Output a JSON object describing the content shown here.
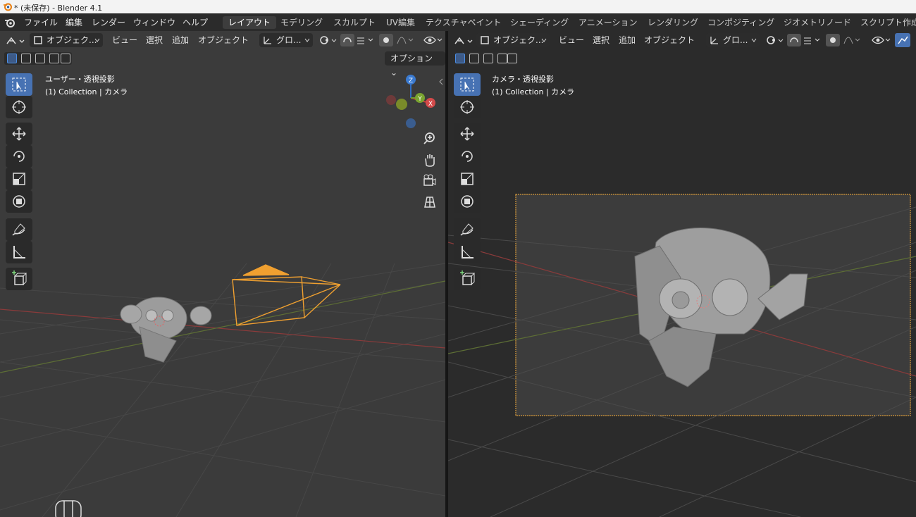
{
  "window": {
    "title": "* (未保存) - Blender 4.1"
  },
  "menu": {
    "items": [
      "ファイル",
      "編集",
      "レンダー",
      "ウィンドウ",
      "ヘルプ"
    ]
  },
  "workspaces": {
    "tabs": [
      "レイアウト",
      "モデリング",
      "スカルプト",
      "UV編集",
      "テクスチャペイント",
      "シェーディング",
      "アニメーション",
      "レンダリング",
      "コンポジティング",
      "ジオメトリノード",
      "スクリプト作成"
    ],
    "active": "レイアウト"
  },
  "left_viewport": {
    "header": {
      "mode": "オブジェク...",
      "menus": [
        "ビュー",
        "選択",
        "追加",
        "オブジェクト"
      ],
      "transform": "グロ..."
    },
    "options": "オプション",
    "label_view": "ユーザー・透視投影",
    "label_collection": "(1) Collection | カメラ",
    "gizmo": {
      "z": "Z",
      "y": "Y",
      "x": "X"
    }
  },
  "right_viewport": {
    "header": {
      "mode": "オブジェク...",
      "menus": [
        "ビュー",
        "選択",
        "追加",
        "オブジェクト"
      ],
      "transform": "グロ..."
    },
    "label_view": "カメラ・透視投影",
    "label_collection": "(1) Collection | カメラ"
  },
  "colors": {
    "accent": "#4772b3",
    "camera": "#f0a030",
    "axis_x": "#b4413f",
    "axis_y": "#7a9a3a"
  }
}
